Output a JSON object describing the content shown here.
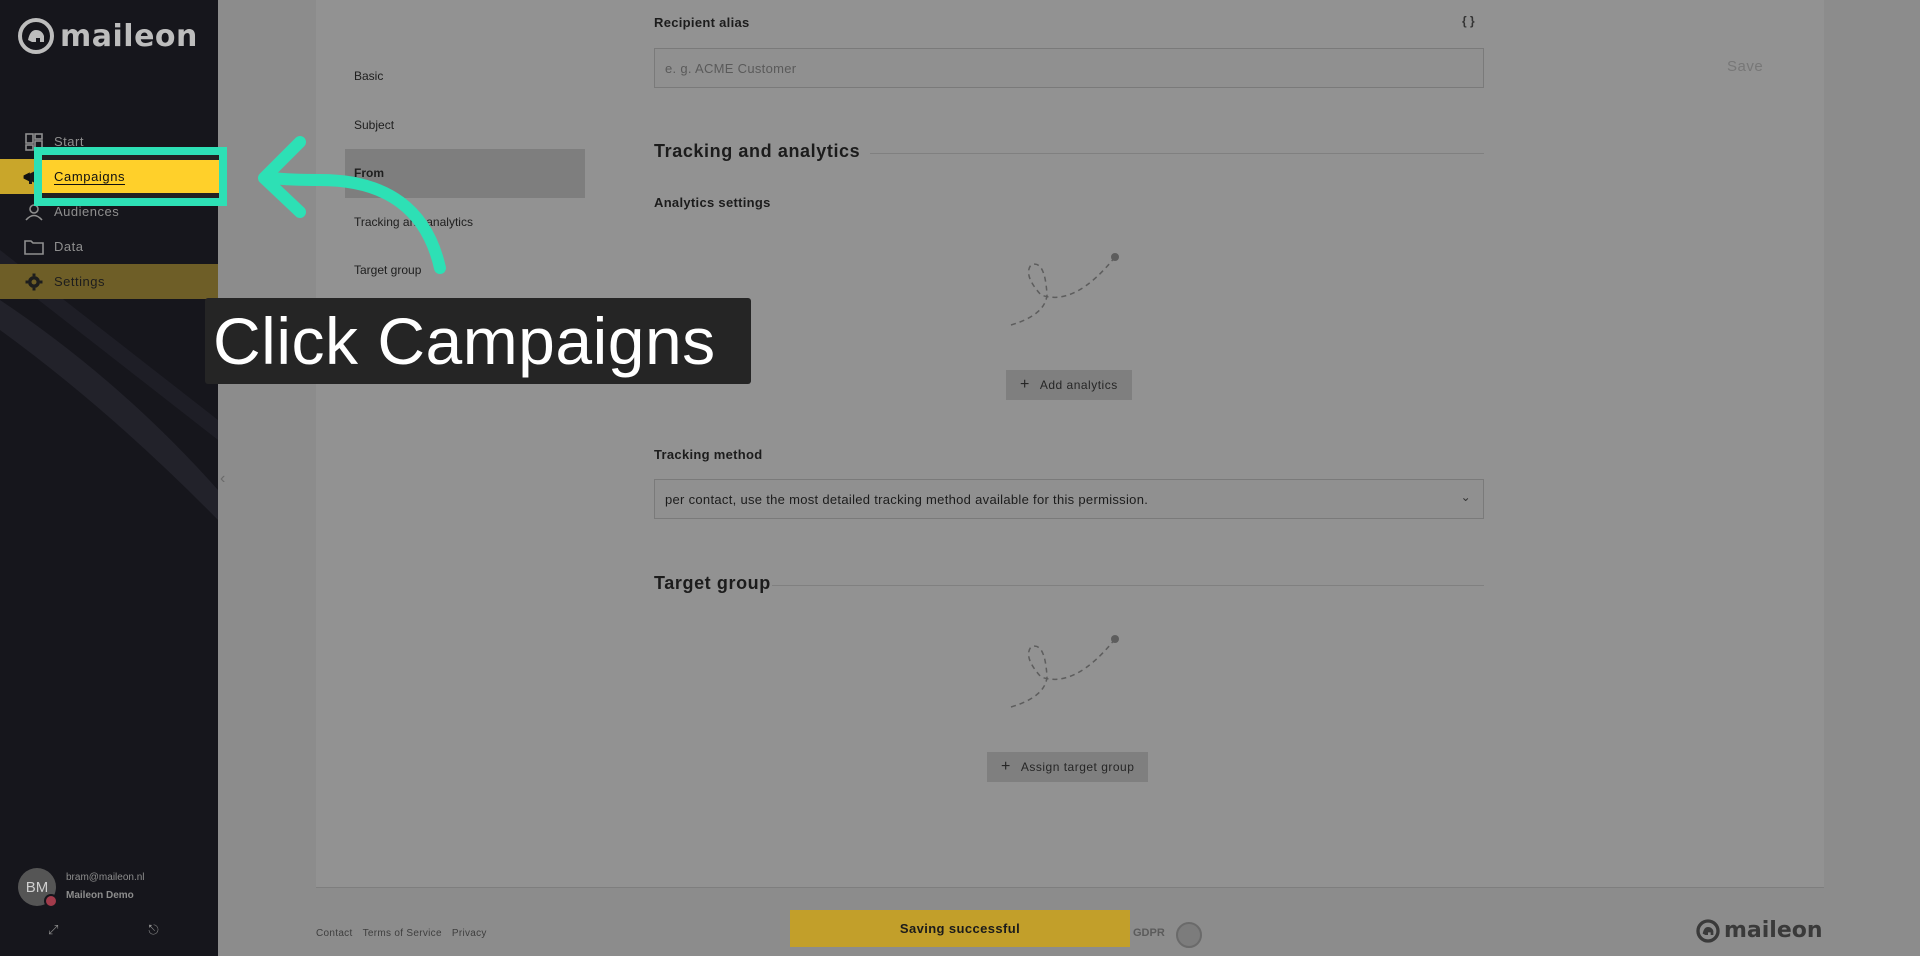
{
  "app": {
    "logo_text": "maileon"
  },
  "sidebar": {
    "items": [
      {
        "label": "Start",
        "icon": "dashboard-icon"
      },
      {
        "label": "Campaigns",
        "icon": "megaphone-icon"
      },
      {
        "label": "Audiences",
        "icon": "user-icon"
      },
      {
        "label": "Data",
        "icon": "folder-icon"
      },
      {
        "label": "Settings",
        "icon": "gear-icon"
      }
    ],
    "user": {
      "initials": "BM",
      "email": "bram@maileon.nl",
      "org": "Maileon Demo"
    }
  },
  "section_nav": [
    {
      "label": "Basic"
    },
    {
      "label": "Subject"
    },
    {
      "label": "From"
    },
    {
      "label": "Tracking and analytics"
    },
    {
      "label": "Target group"
    }
  ],
  "form": {
    "recipient_alias": {
      "label": "Recipient alias",
      "placeholder": "e. g. ACME Customer",
      "value": ""
    },
    "save_label": "Save",
    "tracking_heading": "Tracking and analytics",
    "analytics_label": "Analytics settings",
    "add_analytics_label": "Add analytics",
    "tracking_method": {
      "label": "Tracking method",
      "value": "per contact, use the most detailed tracking method available for this permission."
    },
    "target_group_heading": "Target group",
    "assign_target_group_label": "Assign target group"
  },
  "footer": {
    "links": [
      "Contact",
      "Terms of Service",
      "Privacy"
    ],
    "gdpr": "GDPR",
    "logo_text": "maileon"
  },
  "toast": {
    "message": "Saving successful"
  },
  "tutorial": {
    "callout": "Click Campaigns",
    "accent": "#2de0b5",
    "highlight": "#ffd02a"
  },
  "colors": {
    "sidebar_bg": "#16161c",
    "active_nav": "#c9a62a",
    "overlay_bg": "#8c8c8c"
  }
}
